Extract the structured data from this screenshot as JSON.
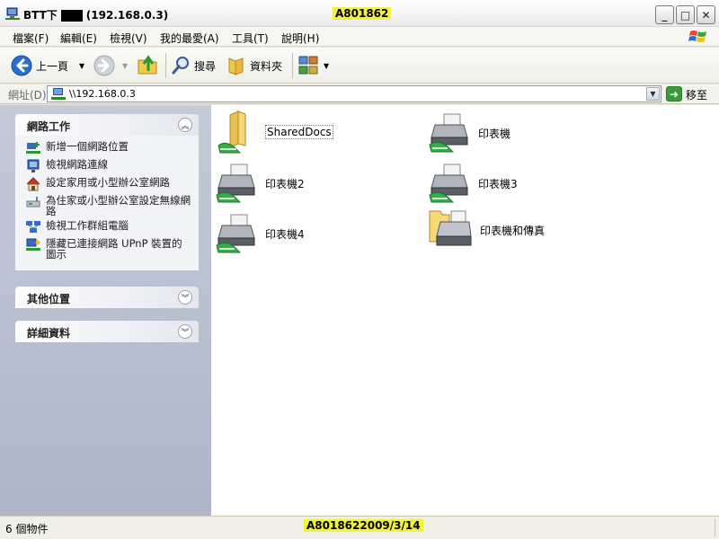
{
  "window": {
    "title_prefix": "BTT下",
    "title_suffix": "(192.168.0.3)",
    "watermark_top": "A801862",
    "buttons": [
      "_",
      "□",
      "✕"
    ]
  },
  "menu": {
    "items": [
      "檔案(F)",
      "編輯(E)",
      "檢視(V)",
      "我的最愛(A)",
      "工具(T)",
      "說明(H)"
    ]
  },
  "toolbar": {
    "back_label": "上一頁",
    "search_label": "搜尋",
    "folders_label": "資料夾"
  },
  "address": {
    "label": "網址(D)",
    "value": "\\\\192.168.0.3",
    "go_label": "移至"
  },
  "sidebar": {
    "network_tasks": {
      "title": "網路工作",
      "items": [
        {
          "label": "新增一個網路位置",
          "icon": "add-network-place-icon"
        },
        {
          "label": "檢視網路連線",
          "icon": "network-connections-icon"
        },
        {
          "label": "設定家用或小型辦公室網路",
          "icon": "home-network-icon"
        },
        {
          "label": "為住家或小型辦公室設定無線網路",
          "icon": "wireless-setup-icon"
        },
        {
          "label": "檢視工作群組電腦",
          "icon": "workgroup-icon"
        },
        {
          "label": "隱藏已連接網路 UPnP 裝置的圖示",
          "icon": "upnp-icon"
        }
      ]
    },
    "other_places": {
      "title": "其他位置"
    },
    "details": {
      "title": "詳細資料"
    }
  },
  "content": {
    "items": [
      {
        "label": "SharedDocs",
        "type": "folder"
      },
      {
        "label": "印表機",
        "type": "shared-printer"
      },
      {
        "label": "印表機2",
        "type": "shared-printer"
      },
      {
        "label": "印表機3",
        "type": "shared-printer"
      },
      {
        "label": "印表機4",
        "type": "shared-printer"
      },
      {
        "label": "印表機和傳真",
        "type": "printers-folder"
      }
    ]
  },
  "status": {
    "count_text": "6 個物件",
    "watermark_bottom": "A8018622009/3/14"
  },
  "colors": {
    "taskpane_bg": "#c4cad8",
    "watermark": "#f2f23c",
    "go_green": "#3a9a3a"
  }
}
